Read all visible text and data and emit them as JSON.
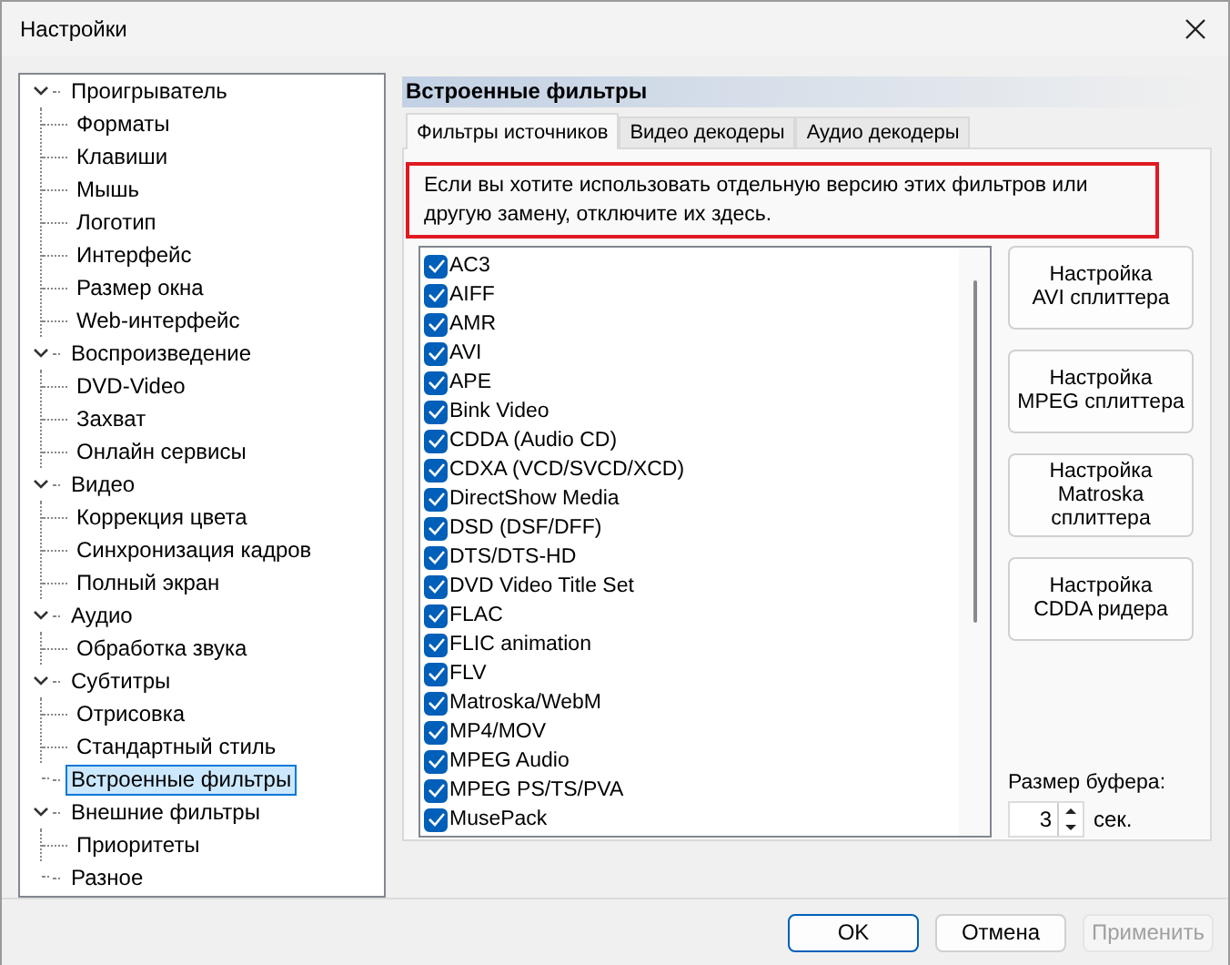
{
  "window": {
    "title": "Настройки"
  },
  "tree": [
    {
      "label": "Проигрыватель",
      "expanded": true,
      "selected": false,
      "children": [
        {
          "label": "Форматы",
          "selected": false
        },
        {
          "label": "Клавиши",
          "selected": false
        },
        {
          "label": "Мышь",
          "selected": false
        },
        {
          "label": "Логотип",
          "selected": false
        },
        {
          "label": "Интерфейс",
          "selected": false
        },
        {
          "label": "Размер окна",
          "selected": false
        },
        {
          "label": "Web-интерфейс",
          "selected": false
        }
      ]
    },
    {
      "label": "Воспроизведение",
      "expanded": true,
      "selected": false,
      "children": [
        {
          "label": "DVD-Video",
          "selected": false
        },
        {
          "label": "Захват",
          "selected": false
        },
        {
          "label": "Онлайн сервисы",
          "selected": false
        }
      ]
    },
    {
      "label": "Видео",
      "expanded": true,
      "selected": false,
      "children": [
        {
          "label": "Коррекция цвета",
          "selected": false
        },
        {
          "label": "Синхронизация кадров",
          "selected": false
        },
        {
          "label": "Полный экран",
          "selected": false
        }
      ]
    },
    {
      "label": "Аудио",
      "expanded": true,
      "selected": false,
      "children": [
        {
          "label": "Обработка звука",
          "selected": false
        }
      ]
    },
    {
      "label": "Субтитры",
      "expanded": true,
      "selected": false,
      "children": [
        {
          "label": "Отрисовка",
          "selected": false
        },
        {
          "label": "Стандартный стиль",
          "selected": false
        }
      ]
    },
    {
      "label": "Встроенные фильтры",
      "selected": true
    },
    {
      "label": "Внешние фильтры",
      "expanded": true,
      "selected": false,
      "children": [
        {
          "label": "Приоритеты",
          "selected": false
        }
      ]
    },
    {
      "label": "Разное",
      "selected": false
    }
  ],
  "page": {
    "heading": "Встроенные фильтры",
    "tabs": [
      {
        "label": "Фильтры источников",
        "selected": true
      },
      {
        "label": "Видео декодеры",
        "selected": false
      },
      {
        "label": "Аудио декодеры",
        "selected": false
      }
    ],
    "notice": "Если вы хотите использовать отдельную версию этих фильтров или другую замену, отключите их здесь.",
    "filters": [
      {
        "label": "AC3",
        "checked": true
      },
      {
        "label": "AIFF",
        "checked": true
      },
      {
        "label": "AMR",
        "checked": true
      },
      {
        "label": "AVI",
        "checked": true
      },
      {
        "label": "APE",
        "checked": true
      },
      {
        "label": "Bink Video",
        "checked": true
      },
      {
        "label": "CDDA (Audio CD)",
        "checked": true
      },
      {
        "label": "CDXA (VCD/SVCD/XCD)",
        "checked": true
      },
      {
        "label": "DirectShow Media",
        "checked": true
      },
      {
        "label": "DSD (DSF/DFF)",
        "checked": true
      },
      {
        "label": "DTS/DTS-HD",
        "checked": true
      },
      {
        "label": "DVD Video Title Set",
        "checked": true
      },
      {
        "label": "FLAC",
        "checked": true
      },
      {
        "label": "FLIC animation",
        "checked": true
      },
      {
        "label": "FLV",
        "checked": true
      },
      {
        "label": "Matroska/WebM",
        "checked": true
      },
      {
        "label": "MP4/MOV",
        "checked": true
      },
      {
        "label": "MPEG Audio",
        "checked": true
      },
      {
        "label": "MPEG PS/TS/PVA",
        "checked": true
      },
      {
        "label": "MusePack",
        "checked": true
      }
    ],
    "side_buttons": [
      [
        "Настройка",
        "AVI сплиттера"
      ],
      [
        "Настройка",
        "MPEG сплиттера"
      ],
      [
        "Настройка",
        "Matroska",
        "сплиттера"
      ],
      [
        "Настройка",
        "CDDA ридера"
      ]
    ],
    "buffer": {
      "label": "Размер буфера:",
      "value": "3",
      "unit": "сек."
    }
  },
  "buttons": [
    {
      "label": "OK",
      "kind": "default",
      "disabled": false
    },
    {
      "label": "Отмена",
      "kind": "normal",
      "disabled": false
    },
    {
      "label": "Применить",
      "kind": "normal",
      "disabled": true
    }
  ]
}
